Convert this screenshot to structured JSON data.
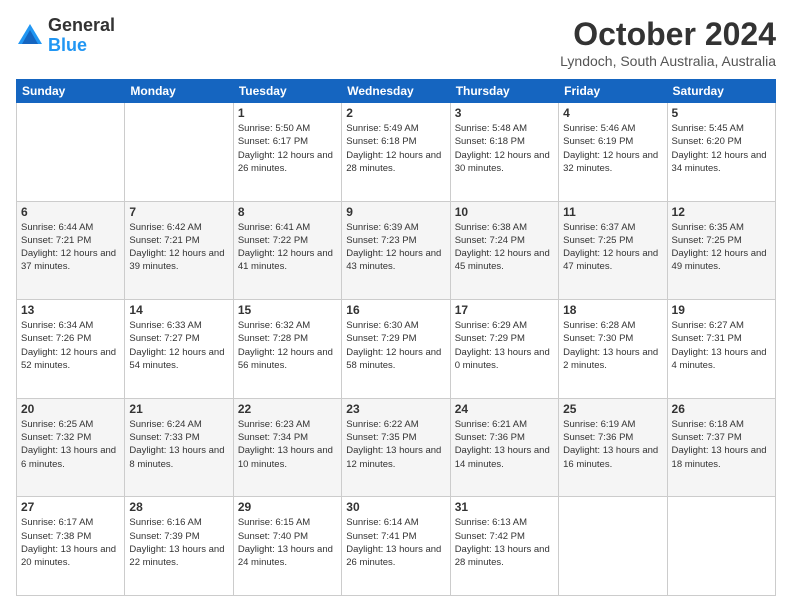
{
  "header": {
    "logo_general": "General",
    "logo_blue": "Blue",
    "month_title": "October 2024",
    "location": "Lyndoch, South Australia, Australia"
  },
  "days_of_week": [
    "Sunday",
    "Monday",
    "Tuesday",
    "Wednesday",
    "Thursday",
    "Friday",
    "Saturday"
  ],
  "weeks": [
    [
      {
        "num": "",
        "info": ""
      },
      {
        "num": "",
        "info": ""
      },
      {
        "num": "1",
        "info": "Sunrise: 5:50 AM\nSunset: 6:17 PM\nDaylight: 12 hours and 26 minutes."
      },
      {
        "num": "2",
        "info": "Sunrise: 5:49 AM\nSunset: 6:18 PM\nDaylight: 12 hours and 28 minutes."
      },
      {
        "num": "3",
        "info": "Sunrise: 5:48 AM\nSunset: 6:18 PM\nDaylight: 12 hours and 30 minutes."
      },
      {
        "num": "4",
        "info": "Sunrise: 5:46 AM\nSunset: 6:19 PM\nDaylight: 12 hours and 32 minutes."
      },
      {
        "num": "5",
        "info": "Sunrise: 5:45 AM\nSunset: 6:20 PM\nDaylight: 12 hours and 34 minutes."
      }
    ],
    [
      {
        "num": "6",
        "info": "Sunrise: 6:44 AM\nSunset: 7:21 PM\nDaylight: 12 hours and 37 minutes."
      },
      {
        "num": "7",
        "info": "Sunrise: 6:42 AM\nSunset: 7:21 PM\nDaylight: 12 hours and 39 minutes."
      },
      {
        "num": "8",
        "info": "Sunrise: 6:41 AM\nSunset: 7:22 PM\nDaylight: 12 hours and 41 minutes."
      },
      {
        "num": "9",
        "info": "Sunrise: 6:39 AM\nSunset: 7:23 PM\nDaylight: 12 hours and 43 minutes."
      },
      {
        "num": "10",
        "info": "Sunrise: 6:38 AM\nSunset: 7:24 PM\nDaylight: 12 hours and 45 minutes."
      },
      {
        "num": "11",
        "info": "Sunrise: 6:37 AM\nSunset: 7:25 PM\nDaylight: 12 hours and 47 minutes."
      },
      {
        "num": "12",
        "info": "Sunrise: 6:35 AM\nSunset: 7:25 PM\nDaylight: 12 hours and 49 minutes."
      }
    ],
    [
      {
        "num": "13",
        "info": "Sunrise: 6:34 AM\nSunset: 7:26 PM\nDaylight: 12 hours and 52 minutes."
      },
      {
        "num": "14",
        "info": "Sunrise: 6:33 AM\nSunset: 7:27 PM\nDaylight: 12 hours and 54 minutes."
      },
      {
        "num": "15",
        "info": "Sunrise: 6:32 AM\nSunset: 7:28 PM\nDaylight: 12 hours and 56 minutes."
      },
      {
        "num": "16",
        "info": "Sunrise: 6:30 AM\nSunset: 7:29 PM\nDaylight: 12 hours and 58 minutes."
      },
      {
        "num": "17",
        "info": "Sunrise: 6:29 AM\nSunset: 7:29 PM\nDaylight: 13 hours and 0 minutes."
      },
      {
        "num": "18",
        "info": "Sunrise: 6:28 AM\nSunset: 7:30 PM\nDaylight: 13 hours and 2 minutes."
      },
      {
        "num": "19",
        "info": "Sunrise: 6:27 AM\nSunset: 7:31 PM\nDaylight: 13 hours and 4 minutes."
      }
    ],
    [
      {
        "num": "20",
        "info": "Sunrise: 6:25 AM\nSunset: 7:32 PM\nDaylight: 13 hours and 6 minutes."
      },
      {
        "num": "21",
        "info": "Sunrise: 6:24 AM\nSunset: 7:33 PM\nDaylight: 13 hours and 8 minutes."
      },
      {
        "num": "22",
        "info": "Sunrise: 6:23 AM\nSunset: 7:34 PM\nDaylight: 13 hours and 10 minutes."
      },
      {
        "num": "23",
        "info": "Sunrise: 6:22 AM\nSunset: 7:35 PM\nDaylight: 13 hours and 12 minutes."
      },
      {
        "num": "24",
        "info": "Sunrise: 6:21 AM\nSunset: 7:36 PM\nDaylight: 13 hours and 14 minutes."
      },
      {
        "num": "25",
        "info": "Sunrise: 6:19 AM\nSunset: 7:36 PM\nDaylight: 13 hours and 16 minutes."
      },
      {
        "num": "26",
        "info": "Sunrise: 6:18 AM\nSunset: 7:37 PM\nDaylight: 13 hours and 18 minutes."
      }
    ],
    [
      {
        "num": "27",
        "info": "Sunrise: 6:17 AM\nSunset: 7:38 PM\nDaylight: 13 hours and 20 minutes."
      },
      {
        "num": "28",
        "info": "Sunrise: 6:16 AM\nSunset: 7:39 PM\nDaylight: 13 hours and 22 minutes."
      },
      {
        "num": "29",
        "info": "Sunrise: 6:15 AM\nSunset: 7:40 PM\nDaylight: 13 hours and 24 minutes."
      },
      {
        "num": "30",
        "info": "Sunrise: 6:14 AM\nSunset: 7:41 PM\nDaylight: 13 hours and 26 minutes."
      },
      {
        "num": "31",
        "info": "Sunrise: 6:13 AM\nSunset: 7:42 PM\nDaylight: 13 hours and 28 minutes."
      },
      {
        "num": "",
        "info": ""
      },
      {
        "num": "",
        "info": ""
      }
    ]
  ]
}
